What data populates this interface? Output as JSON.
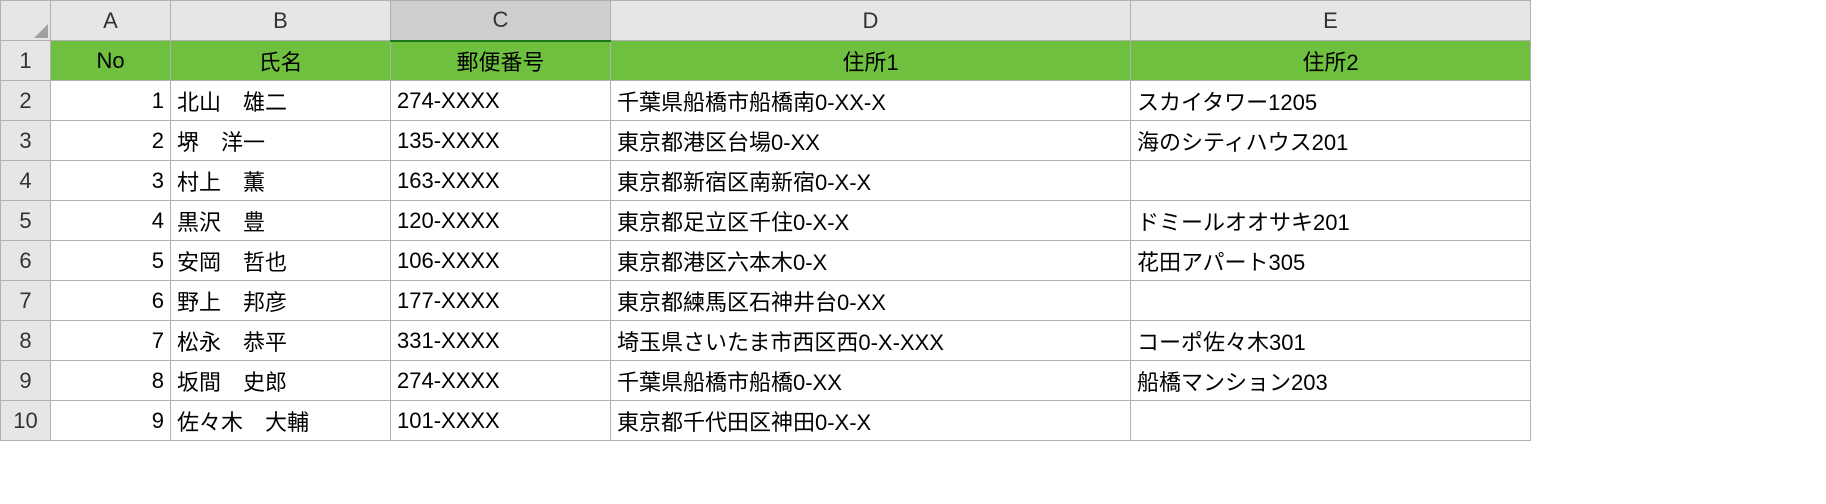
{
  "columns": [
    "A",
    "B",
    "C",
    "D",
    "E"
  ],
  "selected_column": "C",
  "row_numbers": [
    1,
    2,
    3,
    4,
    5,
    6,
    7,
    8,
    9,
    10
  ],
  "headers": {
    "A": "No",
    "B": "氏名",
    "C": "郵便番号",
    "D": "住所1",
    "E": "住所2"
  },
  "rows": [
    {
      "no": "1",
      "name": "北山　雄二",
      "zip": "274-XXXX",
      "addr1": "千葉県船橋市船橋南0-XX-X",
      "addr2": "スカイタワー1205"
    },
    {
      "no": "2",
      "name": "堺　洋一",
      "zip": "135-XXXX",
      "addr1": "東京都港区台場0-XX",
      "addr2": "海のシティハウス201"
    },
    {
      "no": "3",
      "name": "村上　薫",
      "zip": "163-XXXX",
      "addr1": "東京都新宿区南新宿0-X-X",
      "addr2": ""
    },
    {
      "no": "4",
      "name": "黒沢　豊",
      "zip": "120-XXXX",
      "addr1": "東京都足立区千住0-X-X",
      "addr2": "ドミールオオサキ201"
    },
    {
      "no": "5",
      "name": "安岡　哲也",
      "zip": "106-XXXX",
      "addr1": "東京都港区六本木0-X",
      "addr2": "花田アパート305"
    },
    {
      "no": "6",
      "name": "野上　邦彦",
      "zip": "177-XXXX",
      "addr1": "東京都練馬区石神井台0-XX",
      "addr2": ""
    },
    {
      "no": "7",
      "name": "松永　恭平",
      "zip": "331-XXXX",
      "addr1": "埼玉県さいたま市西区西0-X-XXX",
      "addr2": "コーポ佐々木301"
    },
    {
      "no": "8",
      "name": "坂間　史郎",
      "zip": "274-XXXX",
      "addr1": "千葉県船橋市船橋0-XX",
      "addr2": "船橋マンション203"
    },
    {
      "no": "9",
      "name": "佐々木　大輔",
      "zip": "101-XXXX",
      "addr1": "東京都千代田区神田0-X-X",
      "addr2": ""
    }
  ]
}
